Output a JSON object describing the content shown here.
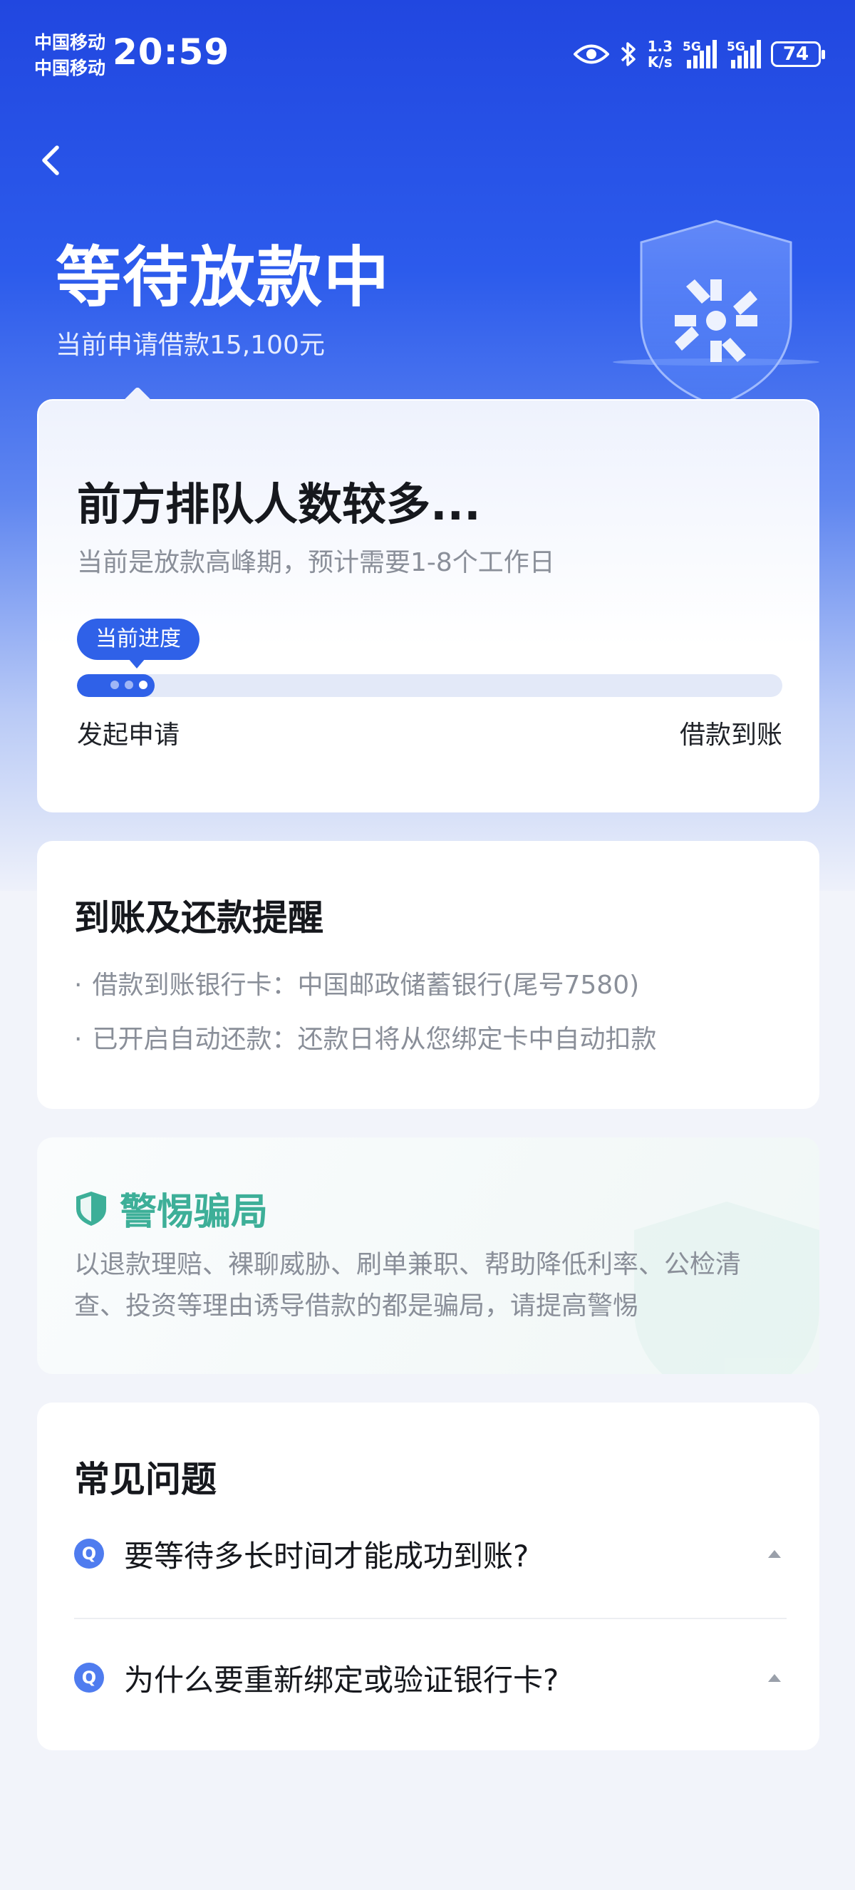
{
  "status_bar": {
    "carrier1": "中国移动",
    "carrier2": "中国移动",
    "time": "20:59",
    "net_speed_value": "1.3",
    "net_speed_unit": "K/s",
    "signal1_label": "5G",
    "signal2_label": "5G",
    "battery": "74",
    "icons": [
      "eye-icon",
      "bluetooth-icon",
      "signal-icon",
      "battery-icon"
    ]
  },
  "header": {
    "title": "等待放款中",
    "subtitle": "当前申请借款15,100元"
  },
  "progress_card": {
    "title": "前方排队人数较多...",
    "subtitle": "当前是放款高峰期，预计需要1-8个工作日",
    "tip": "当前进度",
    "progress_fraction": 0.11,
    "start_label": "发起申请",
    "end_label": "借款到账"
  },
  "reminder_card": {
    "title": "到账及还款提醒",
    "items": [
      "借款到账银行卡：中国邮政储蓄银行(尾号7580)",
      "已开启自动还款：还款日将从您绑定卡中自动扣款"
    ]
  },
  "warning_card": {
    "title": "警惕骗局",
    "body": "以退款理赔、裸聊威胁、刷单兼职、帮助降低利率、公检清查、投资等理由诱导借款的都是骗局，请提高警惕"
  },
  "faq": {
    "title": "常见问题",
    "badge": "Q",
    "items": [
      "要等待多长时间才能成功到账?",
      "为什么要重新绑定或验证银行卡?"
    ]
  },
  "colors": {
    "primary": "#2f61e8",
    "header_bg": "#2147e0",
    "warning_green": "#3daf98"
  }
}
